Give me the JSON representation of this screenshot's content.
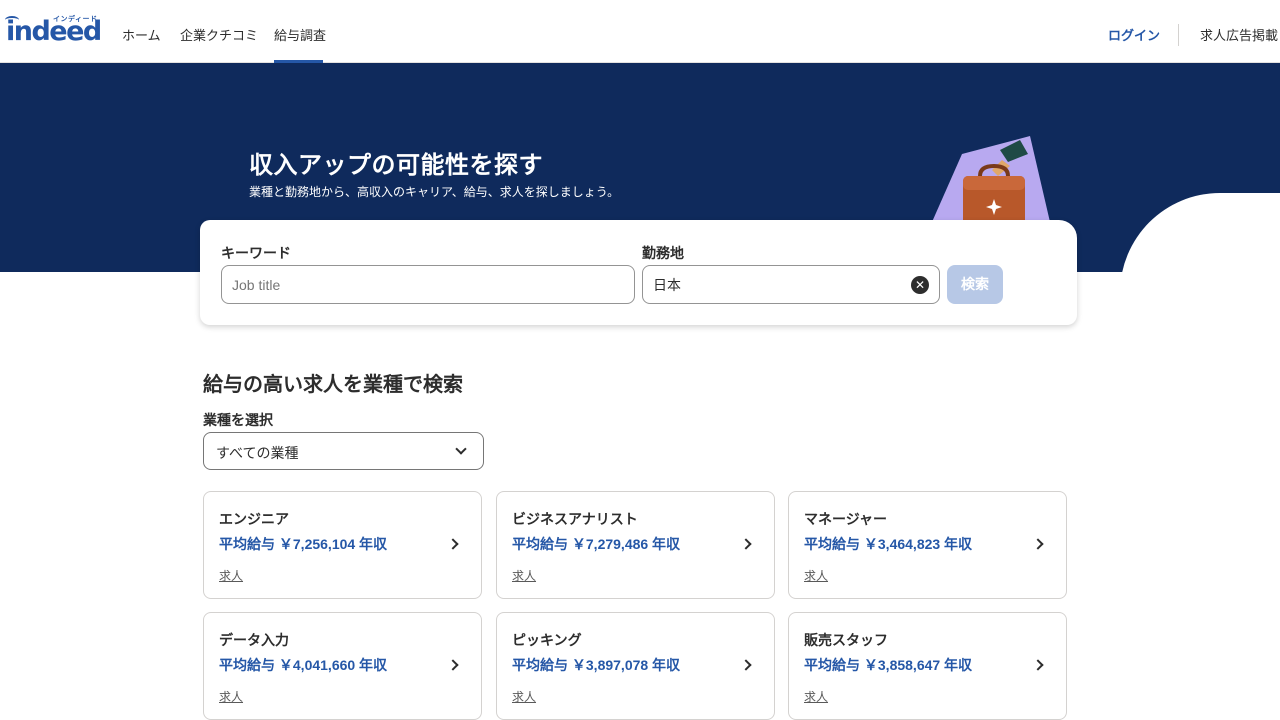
{
  "header": {
    "logo_text": "indeed",
    "logo_kana": "インディード",
    "nav": {
      "home": "ホーム",
      "reviews": "企業クチコミ",
      "salary": "給与調査"
    },
    "login": "ログイン",
    "post_job": "求人広告掲載"
  },
  "hero": {
    "title": "収入アップの可能性を探す",
    "subtitle": "業種と勤務地から、高収入のキャリア、給与、求人を探しましょう。"
  },
  "search": {
    "keyword_label": "キーワード",
    "keyword_placeholder": "Job title",
    "location_label": "勤務地",
    "location_value": "日本",
    "clear_symbol": "✕",
    "button": "検索"
  },
  "section": {
    "title": "給与の高い求人を業種で検索",
    "select_label": "業種を選択",
    "select_value": "すべての業種"
  },
  "cards": [
    {
      "title": "エンジニア",
      "salary": "平均給与 ￥7,256,104 年収",
      "link": "求人"
    },
    {
      "title": "ビジネスアナリスト",
      "salary": "平均給与 ￥7,279,486 年収",
      "link": "求人"
    },
    {
      "title": "マネージャー",
      "salary": "平均給与 ￥3,464,823 年収",
      "link": "求人"
    },
    {
      "title": "データ入力",
      "salary": "平均給与 ￥4,041,660 年収",
      "link": "求人"
    },
    {
      "title": "ピッキング",
      "salary": "平均給与 ￥3,897,078 年収",
      "link": "求人"
    },
    {
      "title": "販売スタッフ",
      "salary": "平均給与 ￥3,858,647 年収",
      "link": "求人"
    }
  ],
  "colors": {
    "brand_blue": "#2557a7",
    "hero_navy": "#0f2a5c",
    "search_button_disabled": "#b7c8e6"
  }
}
